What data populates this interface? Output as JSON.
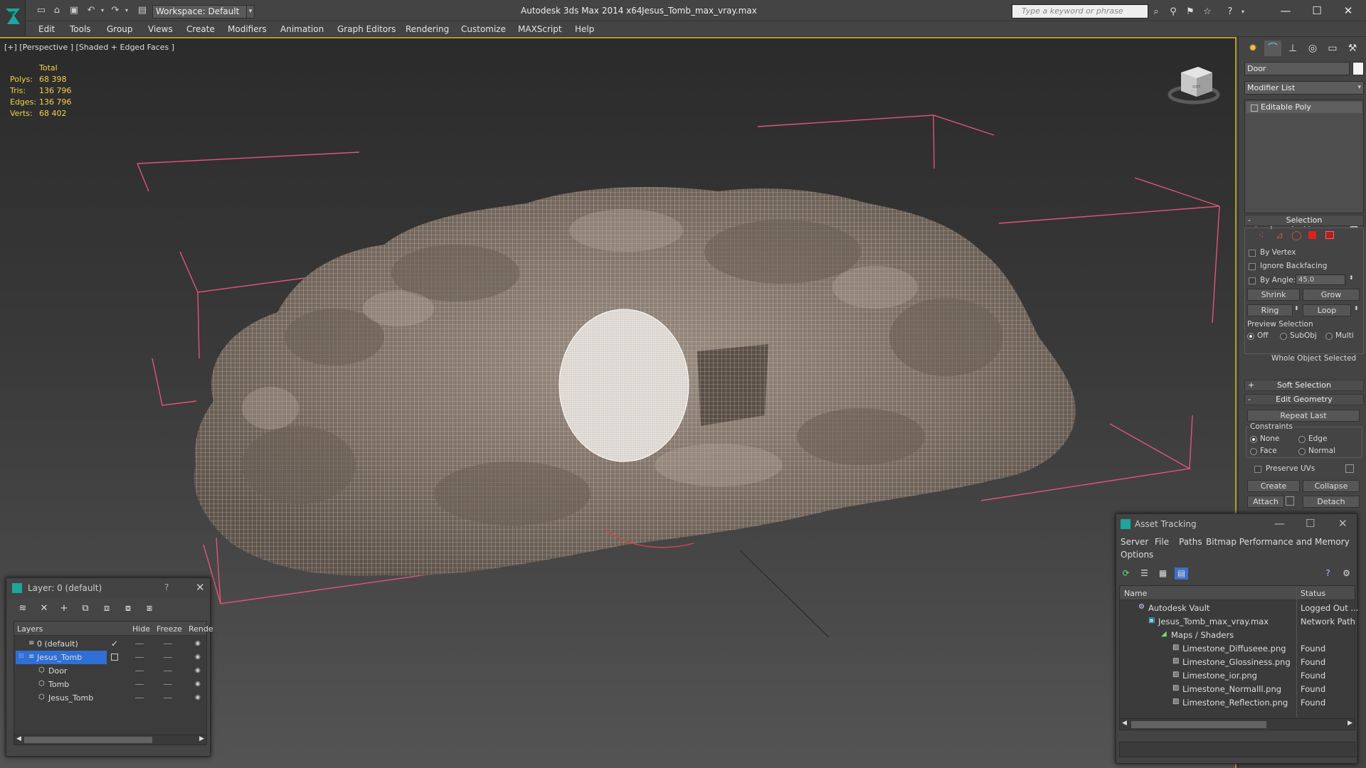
{
  "title_bar": {
    "workspace": "Workspace: Default",
    "app_title": "Autodesk 3ds Max  2014 x64",
    "file_title": "Jesus_Tomb_max_vray.max",
    "search_placeholder": "Type a keyword or phrase"
  },
  "menu": [
    "Edit",
    "Tools",
    "Group",
    "Views",
    "Create",
    "Modifiers",
    "Animation",
    "Graph Editors",
    "Rendering",
    "Customize",
    "MAXScript",
    "Help"
  ],
  "viewport": {
    "label": "[+] [Perspective ] [Shaded + Edged Faces ]",
    "stats": {
      "header": "Total",
      "rows": [
        {
          "k": "Polys:",
          "v": "68 398"
        },
        {
          "k": "Tris:",
          "v": "136 796"
        },
        {
          "k": "Edges:",
          "v": "136 796"
        },
        {
          "k": "Verts:",
          "v": "68 402"
        }
      ]
    },
    "viewcube_text": "ont",
    "colors": {
      "bbox": "#e0557a",
      "wire": "#f0ece8",
      "rock": "#8a7d72"
    }
  },
  "command_panel": {
    "object_name": "Door",
    "modifier_list": "Modifier List",
    "stack_item": "Editable Poly",
    "selection": {
      "title": "Selection",
      "by_vertex": "By Vertex",
      "ignore_backfacing": "Ignore Backfacing",
      "by_angle": "By Angle:",
      "angle_value": "45.0",
      "shrink": "Shrink",
      "grow": "Grow",
      "ring": "Ring",
      "loop": "Loop",
      "preview_selection": "Preview Selection",
      "off": "Off",
      "subobj": "SubObj",
      "multi": "Multi",
      "status": "Whole Object Selected"
    },
    "soft_selection": "Soft Selection",
    "edit_geometry": {
      "title": "Edit Geometry",
      "repeat_last": "Repeat Last",
      "constraints": "Constraints",
      "none": "None",
      "edge": "Edge",
      "face": "Face",
      "normal": "Normal",
      "preserve_uvs": "Preserve UVs",
      "create": "Create",
      "collapse": "Collapse",
      "attach": "Attach",
      "detach": "Detach"
    }
  },
  "layer_dialog": {
    "title": "Layer: 0 (default)",
    "help": "?",
    "columns": {
      "layers": "Layers",
      "hide": "Hide",
      "freeze": "Freeze",
      "render": "Rende"
    },
    "rows": [
      {
        "name": "0 (default)",
        "indent": 1
      },
      {
        "name": "Jesus_Tomb",
        "indent": 1
      },
      {
        "name": "Door",
        "indent": 2
      },
      {
        "name": "Tomb",
        "indent": 2
      },
      {
        "name": "Jesus_Tomb",
        "indent": 2
      }
    ]
  },
  "asset_dialog": {
    "title": "Asset Tracking",
    "menu": [
      "Server",
      "File",
      "Paths",
      "Bitmap Performance and Memory",
      "Options"
    ],
    "columns": {
      "name": "Name",
      "status": "Status"
    },
    "rows": [
      {
        "name": "Autodesk Vault",
        "status": "Logged Out ..."
      },
      {
        "name": "Jesus_Tomb_max_vray.max",
        "status": "Network Path"
      },
      {
        "name": "Maps / Shaders",
        "status": ""
      },
      {
        "name": "Limestone_Diffuseee.png",
        "status": "Found"
      },
      {
        "name": "Limestone_Glossiness.png",
        "status": "Found"
      },
      {
        "name": "Limestone_ior.png",
        "status": "Found"
      },
      {
        "name": "Limestone_Normalll.png",
        "status": "Found"
      },
      {
        "name": "Limestone_Reflection.png",
        "status": "Found"
      }
    ]
  }
}
